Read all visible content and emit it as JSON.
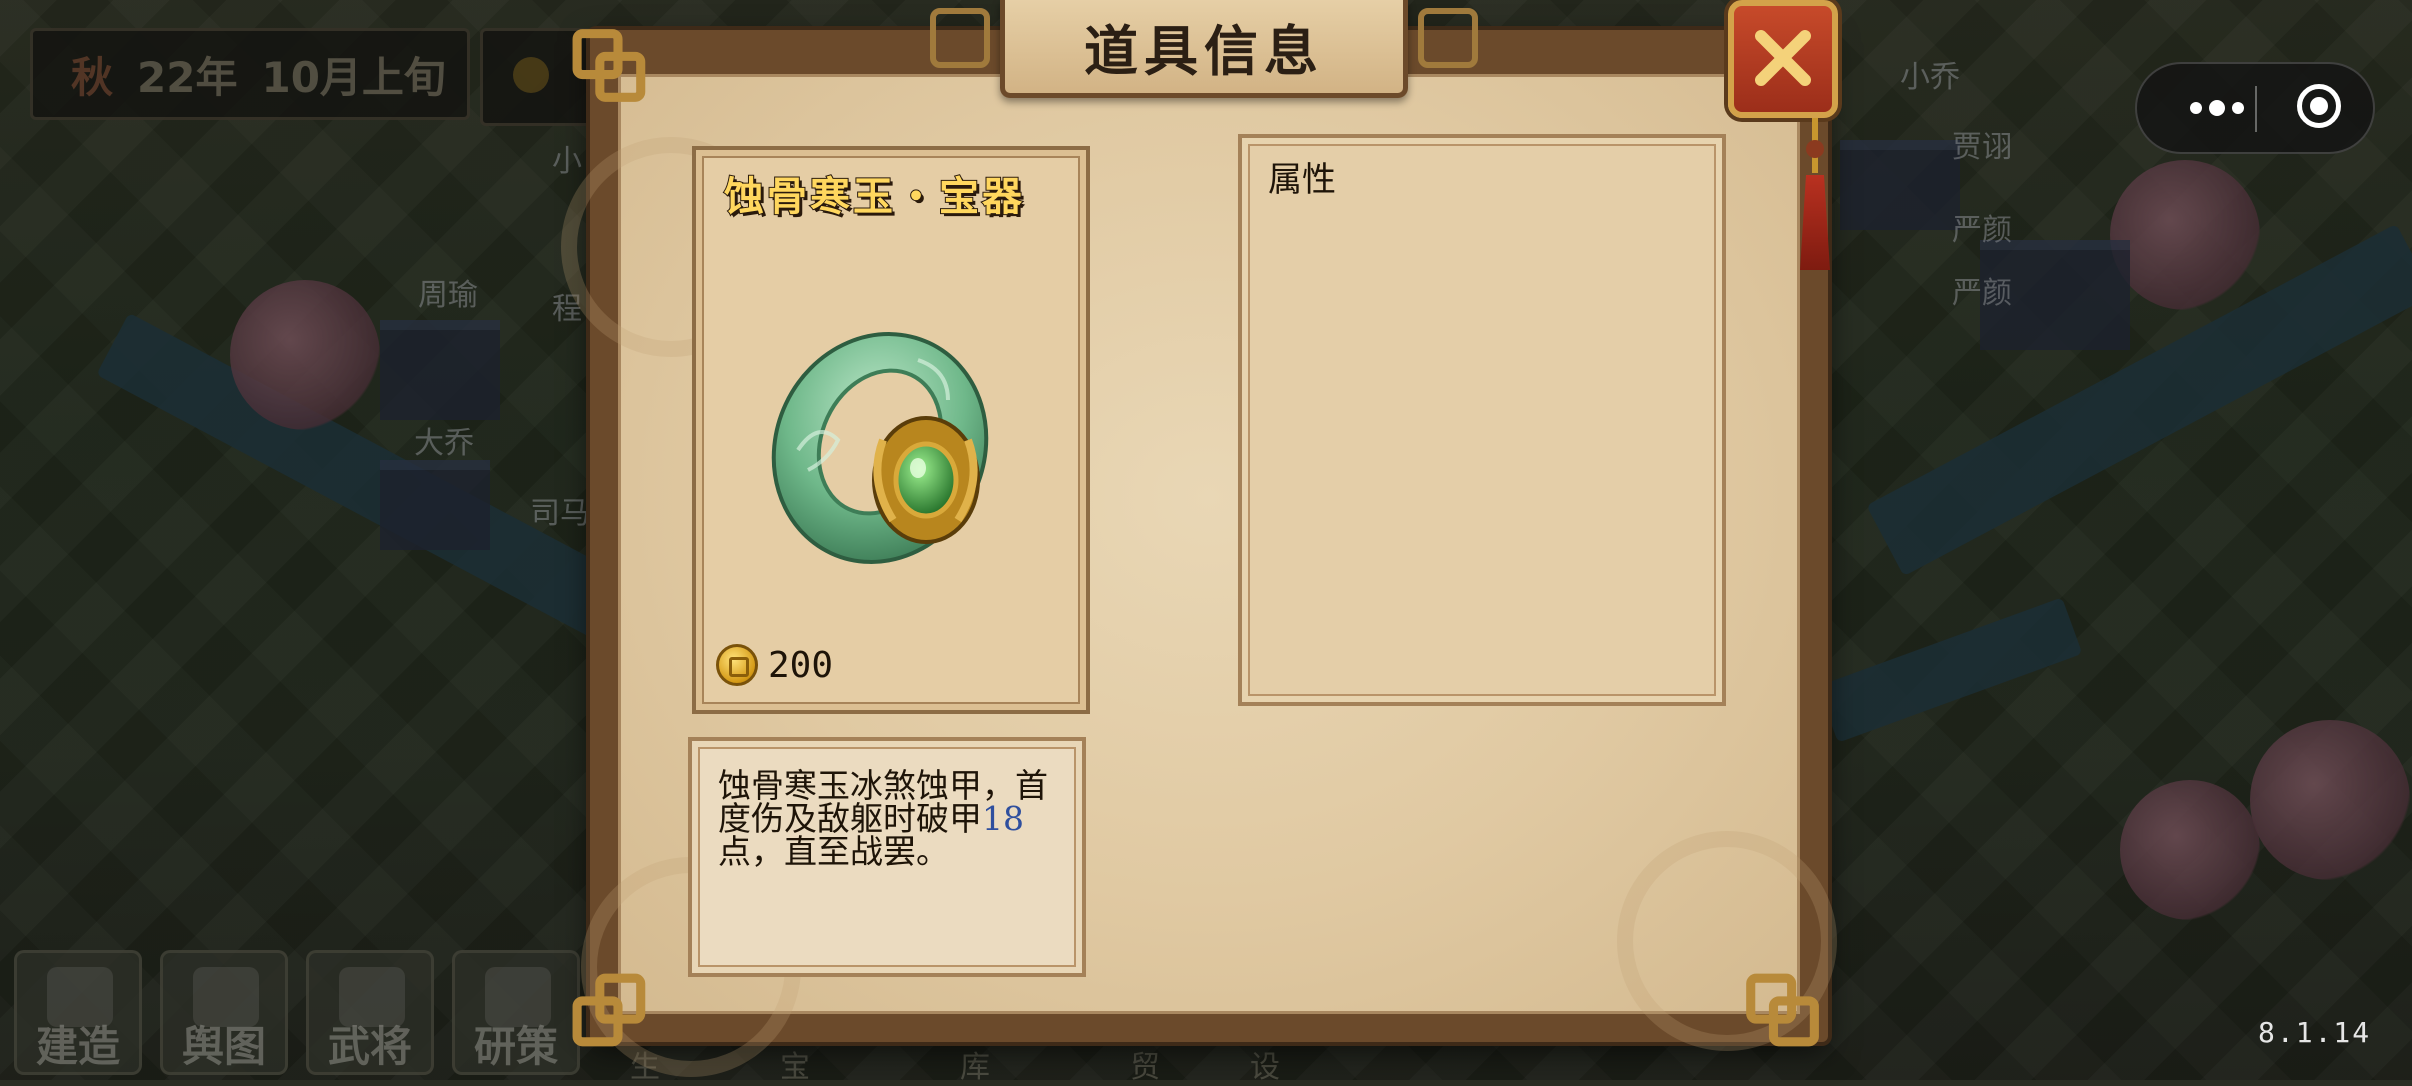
{
  "hud": {
    "season": "秋",
    "year": "22年",
    "month": "10月上旬"
  },
  "map_labels": [
    "小乔",
    "贾诩",
    "严颜",
    "严颜",
    "周瑜",
    "程",
    "大乔",
    "司马",
    "小"
  ],
  "bottom_menu": [
    {
      "label": "建造",
      "icon": "hammer-icon"
    },
    {
      "label": "舆图",
      "icon": "map-icon"
    },
    {
      "label": "武将",
      "icon": "generals-icon"
    },
    {
      "label": "研策",
      "icon": "scroll-icon"
    }
  ],
  "bottom_menu_hidden": [
    "生",
    "宝",
    "库",
    "贸",
    "设"
  ],
  "dialog": {
    "title": "道具信息",
    "close_icon": "close-icon",
    "item": {
      "name": "蚀骨寒玉・宝器",
      "image_icon": "jade-ring-icon",
      "price": "200"
    },
    "attributes": {
      "title": "属性"
    },
    "description": {
      "part1": "蚀骨寒玉冰煞蚀甲，首度伤及敌躯时破甲",
      "number": "18",
      "part2": "点，直至战罢。"
    }
  },
  "capsule": {
    "more_icon": "more-dots-icon",
    "close_icon": "target-icon"
  },
  "version": "8.1.14",
  "colors": {
    "item_name": "#ffd75e",
    "number_highlight": "#2f4f9e",
    "close_button": "#c74a2a",
    "parchment": "#e9d7b5",
    "frame": "#6b4a2b"
  }
}
